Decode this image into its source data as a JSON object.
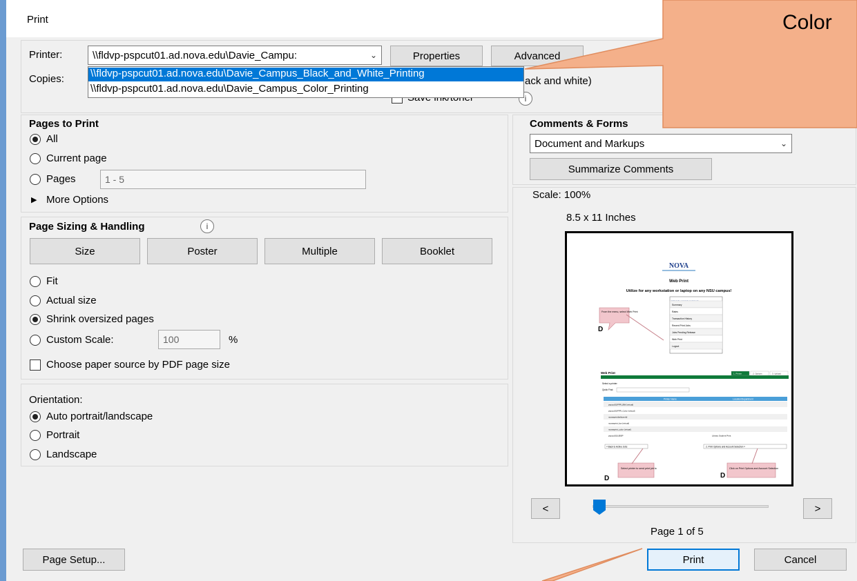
{
  "window": {
    "title": "Print"
  },
  "printer": {
    "label": "Printer:",
    "selected": "\\\\fldvp-pspcut01.ad.nova.edu\\Davie_Campu:",
    "properties_label": "Properties",
    "advanced_label": "Advanced",
    "options": [
      "\\\\fldvp-pspcut01.ad.nova.edu\\Davie_Campus_Black_and_White_Printing",
      "\\\\fldvp-pspcut01.ad.nova.edu\\Davie_Campus_Color_Printing"
    ],
    "grayscale_fragment": "ack and white)",
    "save_ink_label": "Save ink/toner"
  },
  "copies": {
    "label": "Copies:"
  },
  "callout": {
    "text": "Color",
    "color": "#f4b08a"
  },
  "pages_to_print": {
    "title": "Pages to Print",
    "all": "All",
    "current_page": "Current page",
    "pages": "Pages",
    "pages_value": "1 - 5",
    "more_options": "More Options"
  },
  "sizing": {
    "title": "Page Sizing & Handling",
    "buttons": {
      "size": "Size",
      "poster": "Poster",
      "multiple": "Multiple",
      "booklet": "Booklet"
    },
    "fit": "Fit",
    "actual_size": "Actual size",
    "shrink": "Shrink oversized pages",
    "custom_scale": "Custom Scale:",
    "custom_scale_value": "100",
    "percent": "%",
    "paper_source": "Choose paper source by PDF page size"
  },
  "orientation": {
    "title": "Orientation:",
    "auto": "Auto portrait/landscape",
    "portrait": "Portrait",
    "landscape": "Landscape"
  },
  "comments": {
    "title": "Comments & Forms",
    "selected": "Document and Markups",
    "summarize": "Summarize Comments"
  },
  "preview": {
    "scale": "Scale: 100%",
    "paper": "8.5 x 11 Inches",
    "page_info": "Page 1 of 5",
    "prev": "<",
    "next": ">",
    "thumb": {
      "logo": "NOVA",
      "heading": "Web Print",
      "subheading": "Utilize for any workstation or laptop on any NSU campus!",
      "menu_title": "PRINT ACCOUNTING",
      "menu_items": [
        "Summary",
        "Rates",
        "Transaction History",
        "Recent Print Jobs",
        "Jobs Pending Release",
        "Web Print",
        "Logout"
      ],
      "callout_left": "From the menu, select Web Print",
      "callout_bottom_left": "Select printer to send print job to",
      "callout_bottom_right": "Click on Print Options and Account Selection",
      "webprint_title": "Web Print",
      "steps": [
        "1. Printer",
        "2. Options",
        "3. Upload"
      ],
      "select_printer": "Select a printer:",
      "quick_find": "Quick Find:",
      "col_printer": "Printer Name",
      "col_location": "Location/Department",
      "printer_rows": [
        "pspcut01\\FFR_BW (virtual)",
        "pspcut01\\FFR_Color (virtual)",
        "ncrawprintbw\\bwmfd",
        "ncrawprint_bw (virtual)",
        "ncrawprint_color (virtual)",
        "pspcut01\\LIBSP"
      ],
      "row_location": "Library Student Print",
      "btn_left": "2. Print Options and Account Selection »",
      "btn_back": "« Back to Active Jobs",
      "d_label": "D"
    }
  },
  "footer": {
    "page_setup": "Page Setup...",
    "print": "Print",
    "cancel": "Cancel"
  }
}
